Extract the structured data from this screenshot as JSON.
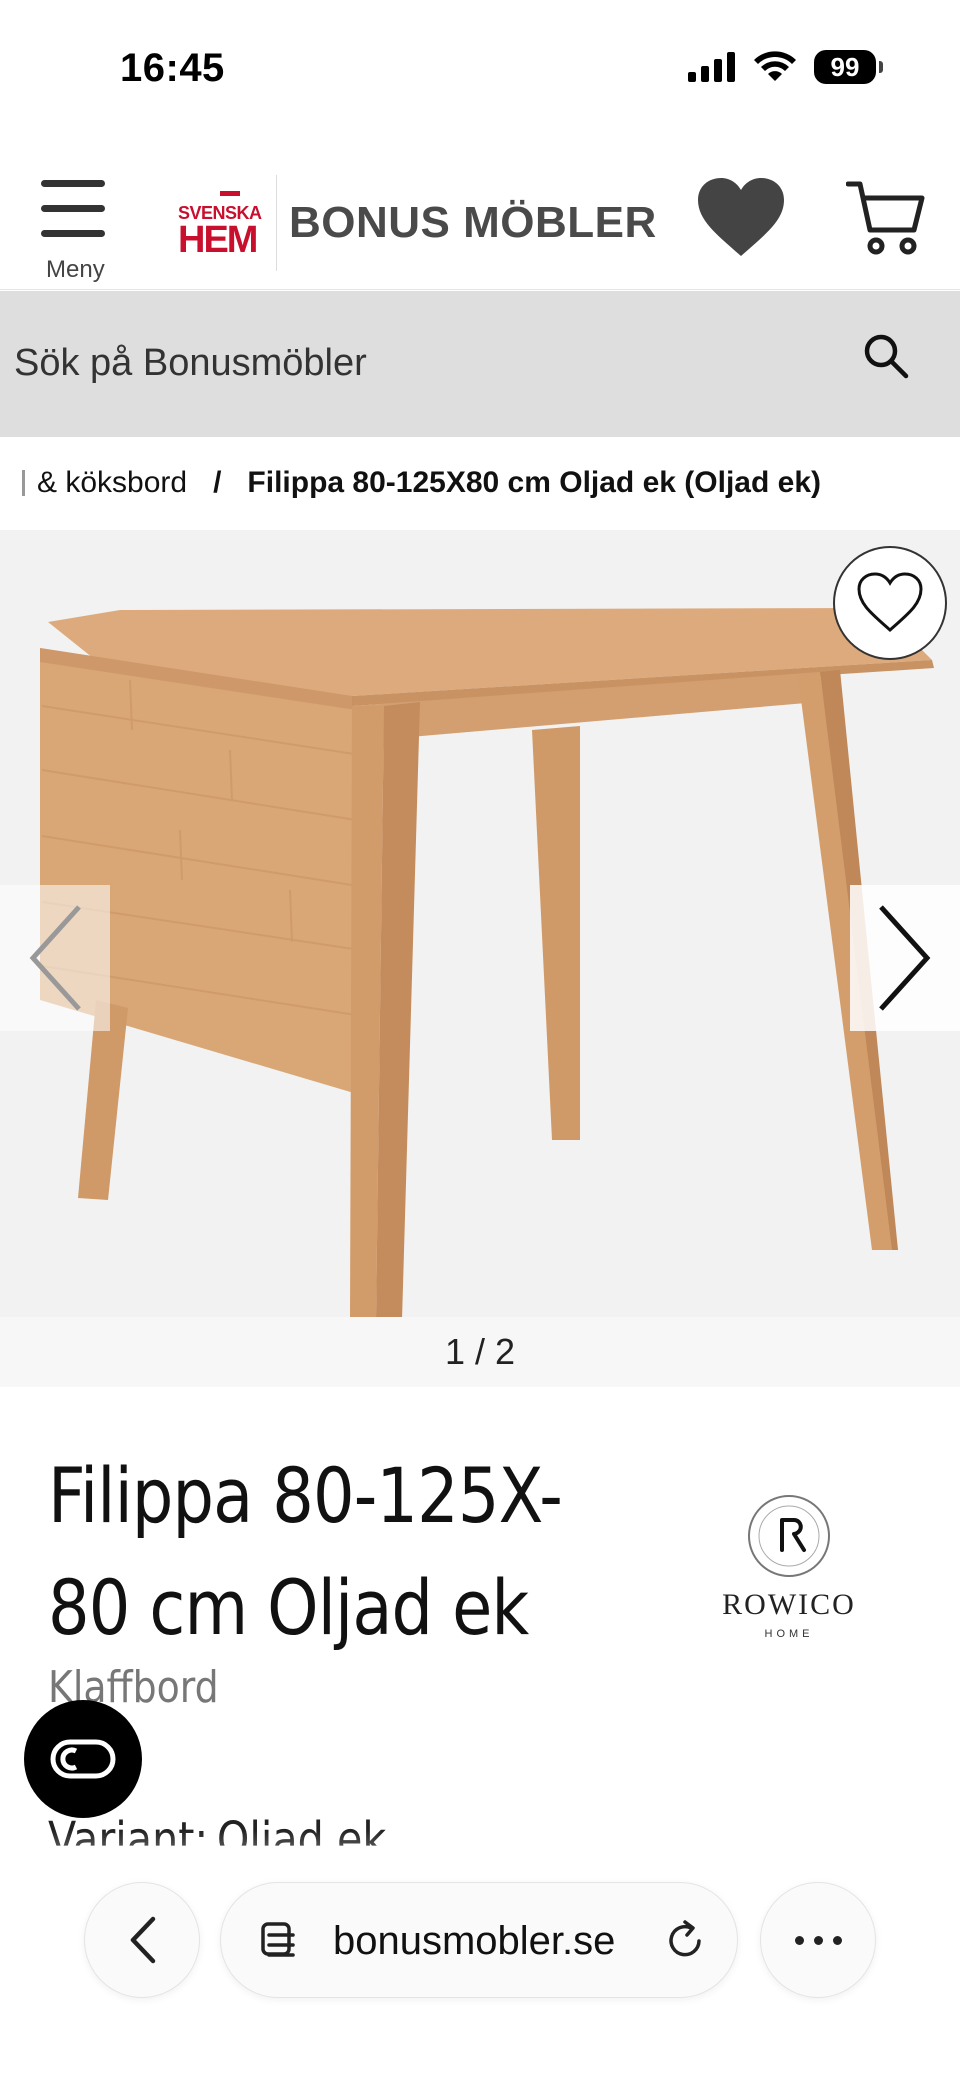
{
  "status_bar": {
    "time": "16:45",
    "battery": "99"
  },
  "header": {
    "menu_label": "Meny",
    "logo": {
      "small": "SVENSKA",
      "big": "HEM",
      "name": "BONUS MÖBLER"
    }
  },
  "search": {
    "placeholder": "Sök på Bonusmöbler"
  },
  "breadcrumb": {
    "items": [
      "& köksbord"
    ],
    "separator": "/",
    "current": "Filippa 80-125X80 cm Oljad ek (Oljad ek)"
  },
  "gallery": {
    "pager": "1 / 2",
    "current": 1,
    "total": 2
  },
  "product": {
    "title": "Filippa 80-125X-80 cm Oljad ek",
    "category": "Klaffbord",
    "variant_label": "Variant:",
    "variant_value": "Oljad ek",
    "brand": {
      "name": "ROWICO",
      "sub": "HOME"
    }
  },
  "browser": {
    "url": "bonusmobler.se"
  },
  "colors": {
    "brand_red": "#c8102e",
    "logo_grey": "#4a4a4a",
    "search_bg": "#dedede",
    "wood": "#d6a374"
  }
}
